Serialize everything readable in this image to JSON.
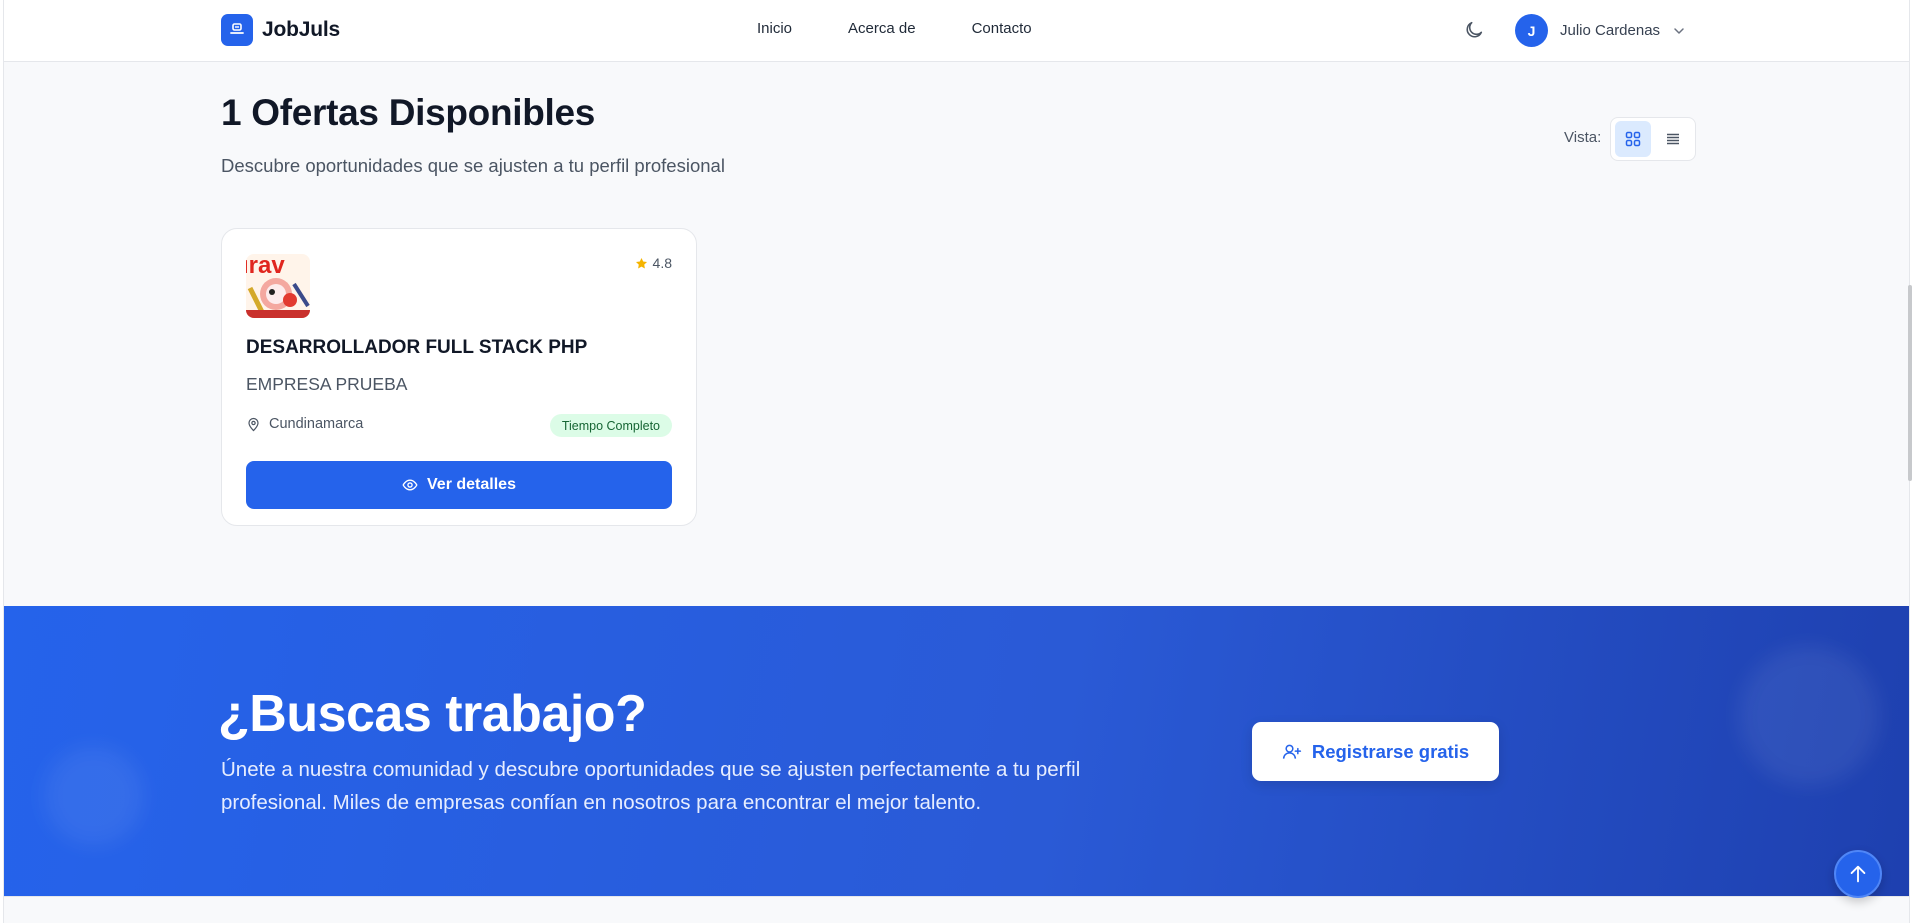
{
  "brand": {
    "name": "JobJuls"
  },
  "nav": {
    "items": [
      "Inicio",
      "Acerca de",
      "Contacto"
    ]
  },
  "user": {
    "initial": "J",
    "name": "Julio Cardenas"
  },
  "header": {
    "title": "1 Ofertas Disponibles",
    "subtitle": "Descubre oportunidades que se ajusten a tu perfil profesional",
    "view_label": "Vista:"
  },
  "job": {
    "rating": "4.8",
    "title": "DESARROLLADOR FULL STACK PHP",
    "company": "EMPRESA PRUEBA",
    "location": "Cundinamarca",
    "type": "Tiempo Completo",
    "details_label": "Ver detalles",
    "logo_text": "irav"
  },
  "cta": {
    "title": "¿Buscas trabajo?",
    "text": "Únete a nuestra comunidad y descubre oportunidades que se ajusten perfectamente a tu perfil profesional. Miles de empresas confían en nosotros para encontrar el mejor talento.",
    "button_label": "Registrarse gratis"
  },
  "colors": {
    "primary": "#2563eb",
    "rating_star": "#f5b400",
    "badge_bg": "#dcfce7",
    "badge_text": "#166534"
  },
  "icons": [
    "briefcase-logo-icon",
    "moon-icon",
    "chevron-down-icon",
    "grid-view-icon",
    "list-view-icon",
    "star-icon",
    "location-pin-icon",
    "eye-icon",
    "user-plus-icon",
    "arrow-up-icon"
  ]
}
